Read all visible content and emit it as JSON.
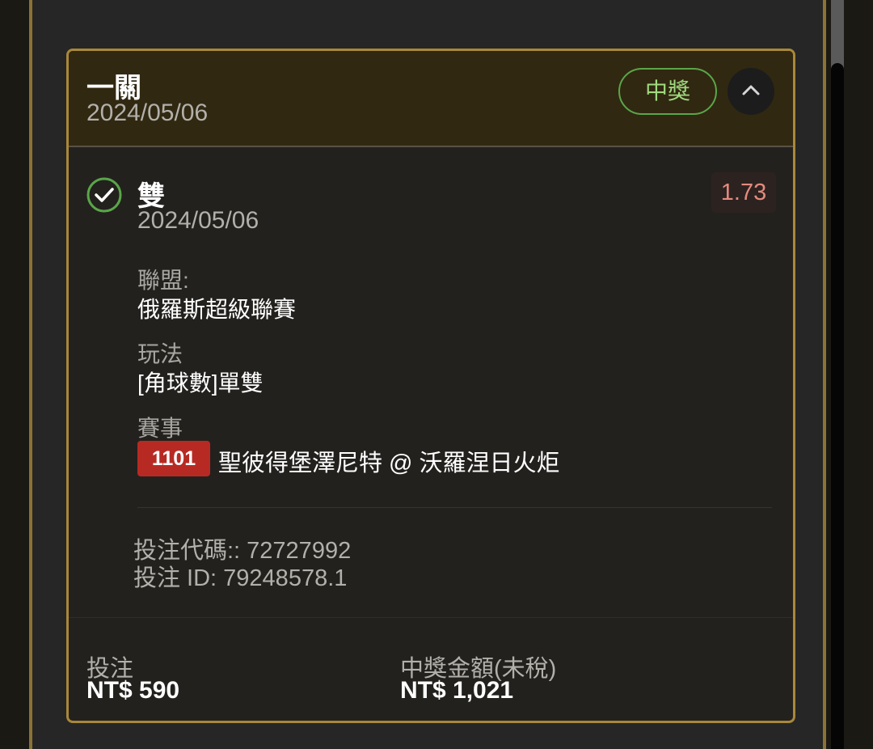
{
  "bet": {
    "type": "一關",
    "date": "2024/05/06",
    "result": "中獎"
  },
  "selection": {
    "name": "雙",
    "date": "2024/05/06",
    "odds": "1.73",
    "status_icon": "check-circle-icon",
    "status_color": "#5aa64a"
  },
  "league": {
    "label": "聯盟:",
    "value": "俄羅斯超級聯賽"
  },
  "market": {
    "label": "玩法",
    "value": "[角球數]單雙"
  },
  "event": {
    "label": "賽事",
    "match_id": "1101",
    "match_name": "聖彼得堡澤尼特 @ 沃羅涅日火炬"
  },
  "codes": {
    "bet_code": "投注代碼:: 72727992",
    "bet_id": "投注 ID: 79248578.1"
  },
  "footer": {
    "stake_label": "投注",
    "stake_value": "NT$ 590",
    "payout_label": "中獎金額(未稅)",
    "payout_value": "NT$ 1,021"
  },
  "colors": {
    "accent_gold": "#a8883a",
    "win_green": "#9fda7f",
    "odds_red": "#e48a7f",
    "match_badge_red": "#b72a23"
  }
}
